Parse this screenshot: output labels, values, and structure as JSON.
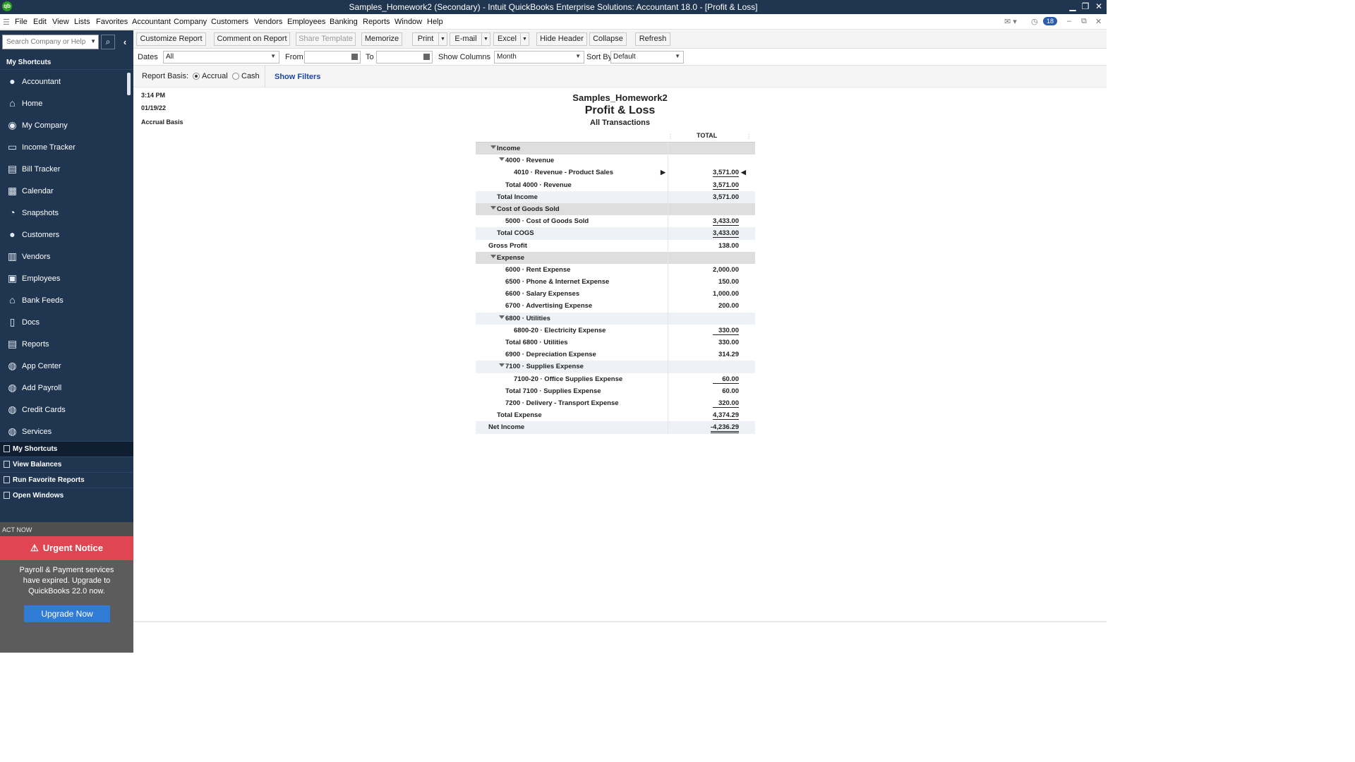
{
  "window": {
    "title": "Samples_Homework2 (Secondary)  - Intuit QuickBooks Enterprise Solutions: Accountant 18.0 - [Profit & Loss]",
    "logo": "qb"
  },
  "menu": [
    "File",
    "Edit",
    "View",
    "Lists",
    "Favorites",
    "Accountant",
    "Company",
    "Customers",
    "Vendors",
    "Employees",
    "Banking",
    "Reports",
    "Window",
    "Help"
  ],
  "reminders_count": "18",
  "sidebar": {
    "search_placeholder": "Search Company or Help",
    "header": "My Shortcuts",
    "items": [
      {
        "label": "Accountant",
        "icon": "person-icon"
      },
      {
        "label": "Home",
        "icon": "home-icon"
      },
      {
        "label": "My Company",
        "icon": "company-icon"
      },
      {
        "label": "Income Tracker",
        "icon": "income-tracker-icon"
      },
      {
        "label": "Bill Tracker",
        "icon": "bill-tracker-icon"
      },
      {
        "label": "Calendar",
        "icon": "calendar-icon"
      },
      {
        "label": "Snapshots",
        "icon": "pie-chart-icon"
      },
      {
        "label": "Customers",
        "icon": "customers-icon"
      },
      {
        "label": "Vendors",
        "icon": "vendors-icon"
      },
      {
        "label": "Employees",
        "icon": "employees-icon"
      },
      {
        "label": "Bank Feeds",
        "icon": "bank-icon"
      },
      {
        "label": "Docs",
        "icon": "docs-icon"
      },
      {
        "label": "Reports",
        "icon": "reports-icon"
      },
      {
        "label": "App Center",
        "icon": "app-center-icon"
      },
      {
        "label": "Add Payroll",
        "icon": "payroll-icon"
      },
      {
        "label": "Credit Cards",
        "icon": "credit-card-icon"
      },
      {
        "label": "Services",
        "icon": "services-icon"
      }
    ],
    "bottom": [
      "My Shortcuts",
      "View Balances",
      "Run Favorite Reports",
      "Open Windows"
    ],
    "act_now": "ACT NOW",
    "urgent": "Urgent Notice",
    "notice": "Payroll & Payment services have expired. Upgrade to QuickBooks 22.0 now.",
    "upgrade_button": "Upgrade Now"
  },
  "toolbar": {
    "customize": "Customize Report",
    "comment": "Comment on Report",
    "share": "Share Template",
    "memorize": "Memorize",
    "print": "Print",
    "email": "E-mail",
    "excel": "Excel",
    "hide_header": "Hide Header",
    "collapse": "Collapse",
    "refresh": "Refresh"
  },
  "filters": {
    "dates_label": "Dates",
    "dates_value": "All",
    "from_label": "From",
    "from_value": "",
    "to_label": "To",
    "to_value": "",
    "show_columns_label": "Show Columns",
    "show_columns_value": "Month",
    "sort_by_label": "Sort By",
    "sort_by_value": "Default"
  },
  "basis": {
    "label": "Report Basis:",
    "accrual": "Accrual",
    "cash": "Cash",
    "selected": "Accrual",
    "show_filters": "Show Filters"
  },
  "report": {
    "time": "3:14 PM",
    "date": "01/19/22",
    "basis": "Accrual Basis",
    "company": "Samples_Homework2",
    "title": "Profit & Loss",
    "subtitle": "All Transactions",
    "column": "TOTAL",
    "rows": [
      {
        "label": "Income",
        "value": "",
        "indent": 1,
        "style": "sec",
        "tri": true
      },
      {
        "label": "4000 · Revenue",
        "value": "",
        "indent": 2,
        "style": "",
        "tri": true
      },
      {
        "label": "4010 · Revenue - Product Sales",
        "value": "3,571.00",
        "indent": 3,
        "style": "",
        "line": "ul",
        "markers": true
      },
      {
        "label": "Total 4000 · Revenue",
        "value": "3,571.00",
        "indent": 2,
        "style": "",
        "line": "ul"
      },
      {
        "label": "Total Income",
        "value": "3,571.00",
        "indent": 1,
        "style": "tot"
      },
      {
        "label": "Cost of Goods Sold",
        "value": "",
        "indent": 1,
        "style": "sec",
        "tri": true
      },
      {
        "label": "5000 · Cost of Goods Sold",
        "value": "3,433.00",
        "indent": 2,
        "style": "",
        "line": "ul"
      },
      {
        "label": "Total COGS",
        "value": "3,433.00",
        "indent": 1,
        "style": "tot",
        "line": "ul"
      },
      {
        "label": "Gross Profit",
        "value": "138.00",
        "indent": 0,
        "style": ""
      },
      {
        "label": "Expense",
        "value": "",
        "indent": 1,
        "style": "sec",
        "tri": true
      },
      {
        "label": "6000 · Rent Expense",
        "value": "2,000.00",
        "indent": 2,
        "style": ""
      },
      {
        "label": "6500 · Phone & Internet Expense",
        "value": "150.00",
        "indent": 2,
        "style": ""
      },
      {
        "label": "6600 · Salary Expenses",
        "value": "1,000.00",
        "indent": 2,
        "style": ""
      },
      {
        "label": "6700 · Advertising Expense",
        "value": "200.00",
        "indent": 2,
        "style": ""
      },
      {
        "label": "6800 · Utilities",
        "value": "",
        "indent": 2,
        "style": "sub",
        "tri": true
      },
      {
        "label": "6800-20 · Electricity Expense",
        "value": "330.00",
        "indent": 3,
        "style": "",
        "line": "ul"
      },
      {
        "label": "Total 6800 · Utilities",
        "value": "330.00",
        "indent": 2,
        "style": ""
      },
      {
        "label": "6900 · Depreciation Expense",
        "value": "314.29",
        "indent": 2,
        "style": ""
      },
      {
        "label": "7100 · Supplies Expense",
        "value": "",
        "indent": 2,
        "style": "sub",
        "tri": true
      },
      {
        "label": "7100-20 · Office Supplies Expense",
        "value": "60.00",
        "indent": 3,
        "style": "",
        "line": "ul"
      },
      {
        "label": "Total 7100 · Supplies Expense",
        "value": "60.00",
        "indent": 2,
        "style": ""
      },
      {
        "label": "7200 · Delivery - Transport Expense",
        "value": "320.00",
        "indent": 2,
        "style": "",
        "line": "ul"
      },
      {
        "label": "Total Expense",
        "value": "4,374.29",
        "indent": 1,
        "style": "",
        "line": "ul"
      },
      {
        "label": "Net Income",
        "value": "-4,236.29",
        "indent": 0,
        "style": "tot",
        "line": "dul"
      }
    ]
  },
  "colors": {
    "nav": "#1f3550",
    "urgent": "#e04651",
    "upgrade": "#2f7bd6",
    "link": "#1e46a8"
  }
}
